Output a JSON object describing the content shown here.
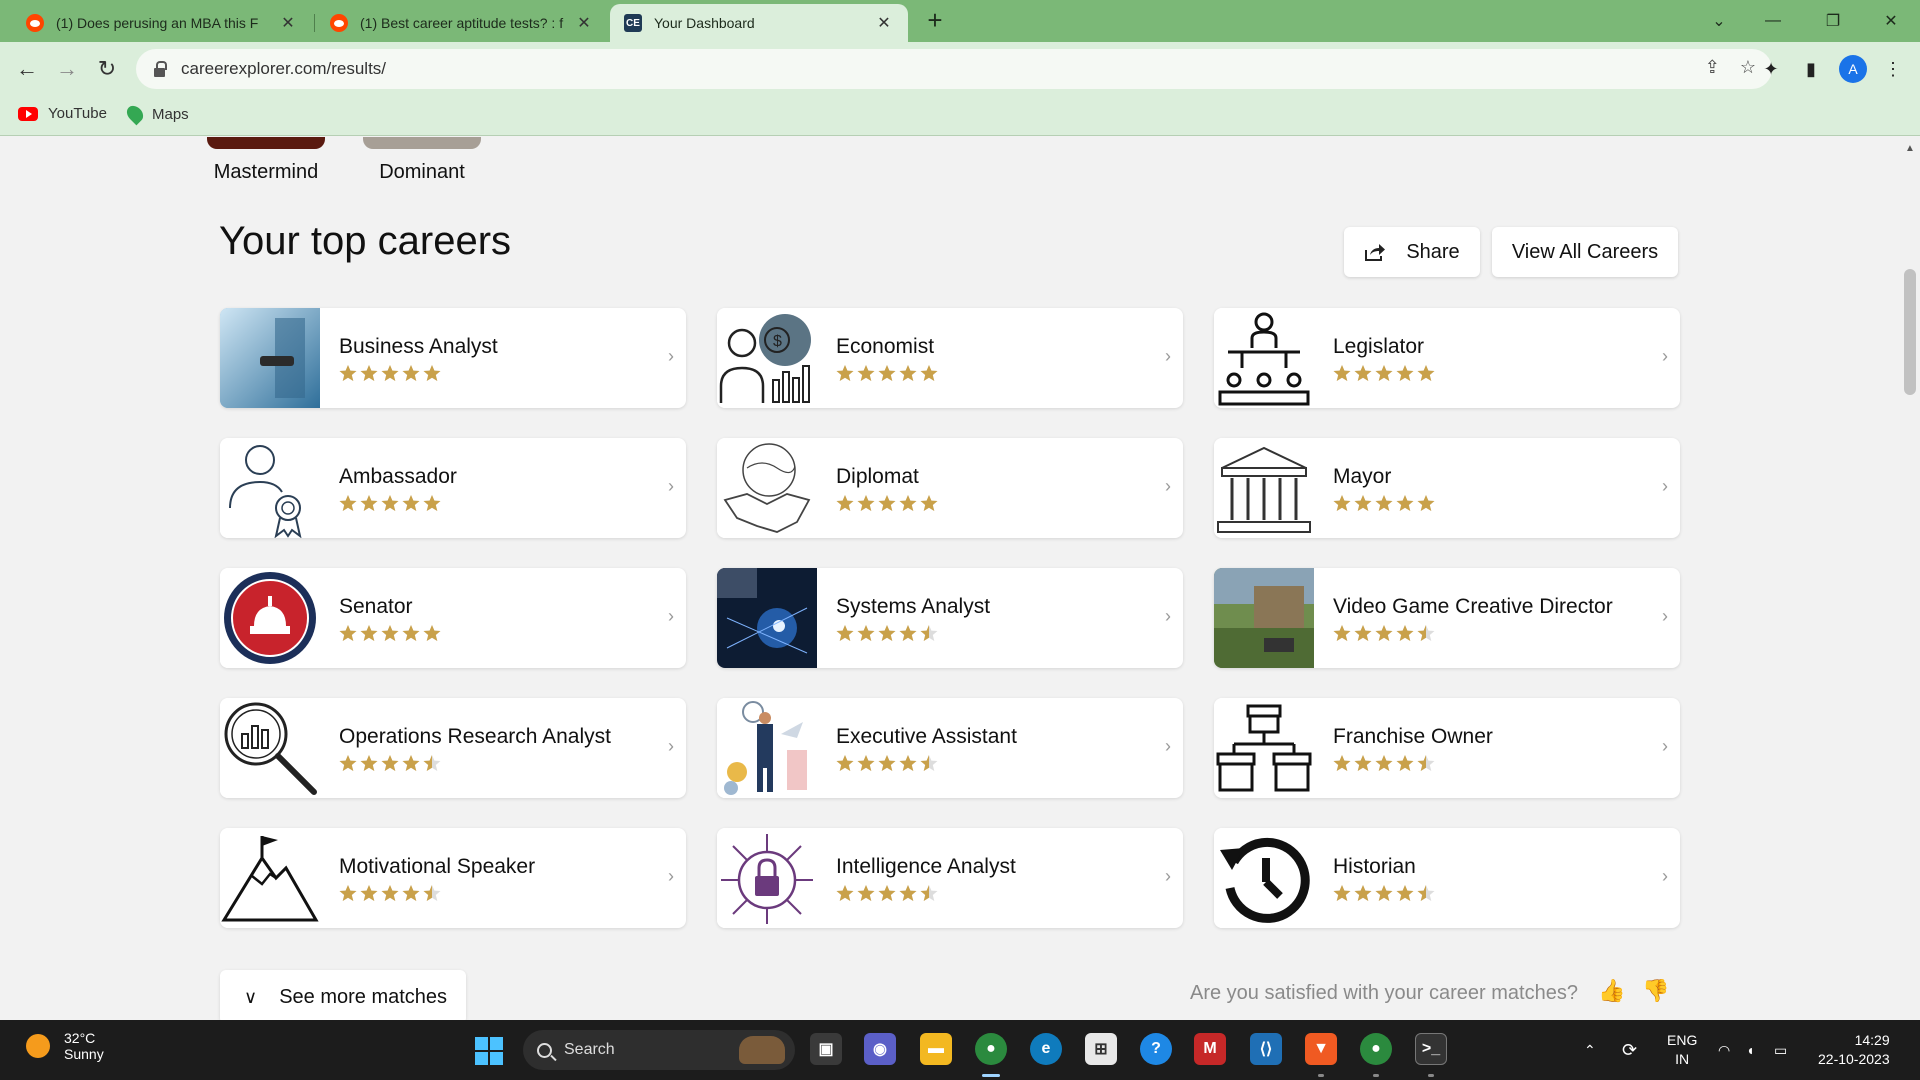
{
  "browser": {
    "tabs": [
      {
        "title": "(1) Does perusing an MBA this F",
        "favicon": "reddit-icon"
      },
      {
        "title": "(1) Best career aptitude tests? : f",
        "favicon": "reddit-icon"
      },
      {
        "title": "Your Dashboard",
        "favicon": "careerexplorer-icon"
      }
    ],
    "url": "careerexplorer.com/results/",
    "avatar_letter": "A",
    "bookmarks": [
      {
        "label": "YouTube",
        "icon": "youtube-icon"
      },
      {
        "label": "Maps",
        "icon": "maps-icon"
      }
    ]
  },
  "personas": [
    {
      "label": "Mastermind",
      "color": "#5a1a10"
    },
    {
      "label": "Dominant",
      "color": "#a79f96"
    }
  ],
  "main": {
    "heading": "Your top careers",
    "share_label": "Share",
    "view_all_label": "View All Careers",
    "see_more_label": "See more matches",
    "satisfied_question": "Are you satisfied with your career matches?"
  },
  "careers": [
    {
      "name": "Business Analyst",
      "rating": 5,
      "icon": "business-analyst-photo"
    },
    {
      "name": "Economist",
      "rating": 5,
      "icon": "economist-icon"
    },
    {
      "name": "Legislator",
      "rating": 5,
      "icon": "legislator-icon"
    },
    {
      "name": "Ambassador",
      "rating": 5,
      "icon": "ambassador-icon"
    },
    {
      "name": "Diplomat",
      "rating": 5,
      "icon": "handshake-globe-icon"
    },
    {
      "name": "Mayor",
      "rating": 5,
      "icon": "city-hall-icon"
    },
    {
      "name": "Senator",
      "rating": 5,
      "icon": "capitol-seal-icon"
    },
    {
      "name": "Systems Analyst",
      "rating": 4.5,
      "icon": "systems-analyst-photo"
    },
    {
      "name": "Video Game Creative Director",
      "rating": 4.5,
      "icon": "video-game-photo"
    },
    {
      "name": "Operations Research Analyst",
      "rating": 4.5,
      "icon": "magnifier-chart-icon"
    },
    {
      "name": "Executive Assistant",
      "rating": 4.5,
      "icon": "executive-assistant-illustration"
    },
    {
      "name": "Franchise Owner",
      "rating": 4.5,
      "icon": "storefronts-icon"
    },
    {
      "name": "Motivational Speaker",
      "rating": 4.5,
      "icon": "mountain-flag-icon"
    },
    {
      "name": "Intelligence Analyst",
      "rating": 4.5,
      "icon": "circuit-lock-icon"
    },
    {
      "name": "Historian",
      "rating": 4.5,
      "icon": "history-clock-icon"
    }
  ],
  "colors": {
    "star": "#c9a14a",
    "tabbar": "#7bb877",
    "toolbar": "#dbeedb"
  },
  "taskbar": {
    "temperature": "32°C",
    "condition": "Sunny",
    "search_placeholder": "Search",
    "lang_top": "ENG",
    "lang_bottom": "IN",
    "time": "14:29",
    "date": "22-10-2023"
  }
}
